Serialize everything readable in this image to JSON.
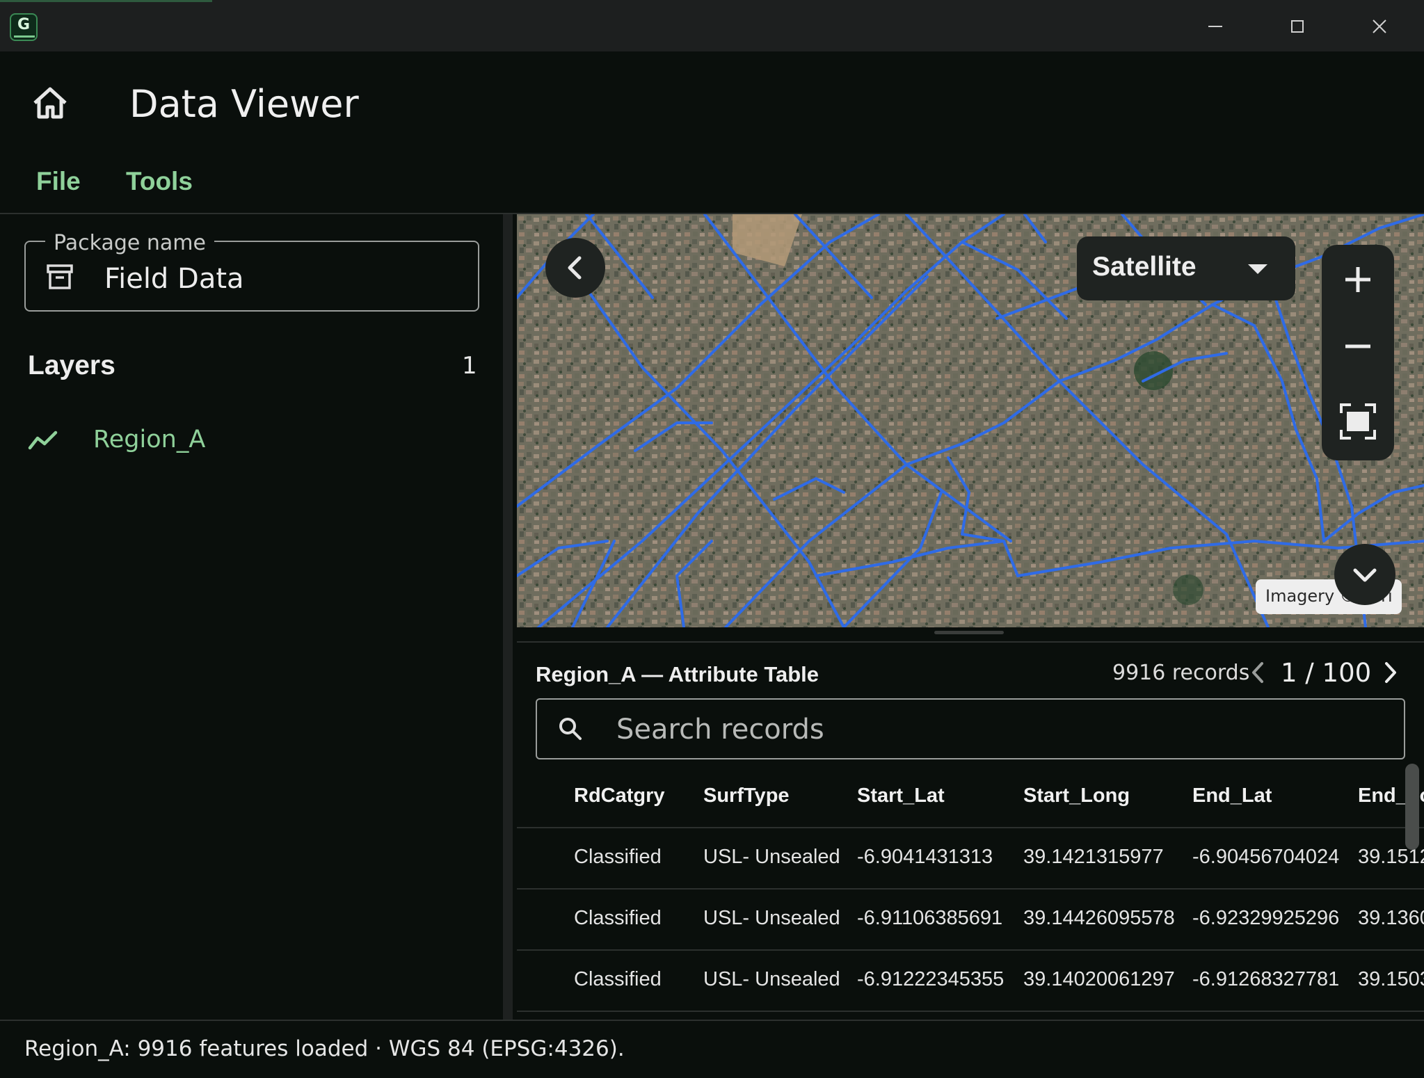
{
  "window": {
    "app_logo_letter": "G",
    "controls": [
      "minimize",
      "maximize",
      "close"
    ]
  },
  "header": {
    "title": "Data Viewer",
    "menu": {
      "file": "File",
      "tools": "Tools"
    }
  },
  "sidebar": {
    "package_label": "Package name",
    "package_value": "Field Data",
    "layers_title": "Layers",
    "layers_count": "1",
    "layers": [
      {
        "name": "Region_A",
        "icon": "polyline-icon"
      }
    ]
  },
  "map": {
    "basemap": "Satellite",
    "attribution": "Imagery © Esri",
    "colors": {
      "roads": "#2f6be6",
      "accent": "#8fd19a"
    }
  },
  "attribute_table": {
    "title": "Region_A — Attribute Table",
    "record_count": "9916 records",
    "page": "1 / 100",
    "search_placeholder": "Search records",
    "columns": [
      "RdCatgry",
      "SurfType",
      "Start_Lat",
      "Start_Long",
      "End_Lat",
      "End_Lo"
    ],
    "rows": [
      [
        "Classified",
        "USL- Unsealed",
        "-6.9041431313",
        "39.1421315977",
        "-6.90456704024",
        "39.1512"
      ],
      [
        "Classified",
        "USL- Unsealed",
        "-6.91106385691",
        "39.14426095578",
        "-6.92329925296",
        "39.1360"
      ],
      [
        "Classified",
        "USL- Unsealed",
        "-6.91222345355",
        "39.14020061297",
        "-6.91268327781",
        "39.1503"
      ]
    ]
  },
  "status": {
    "text": "Region_A: 9916 features loaded · WGS 84 (EPSG:4326)."
  }
}
